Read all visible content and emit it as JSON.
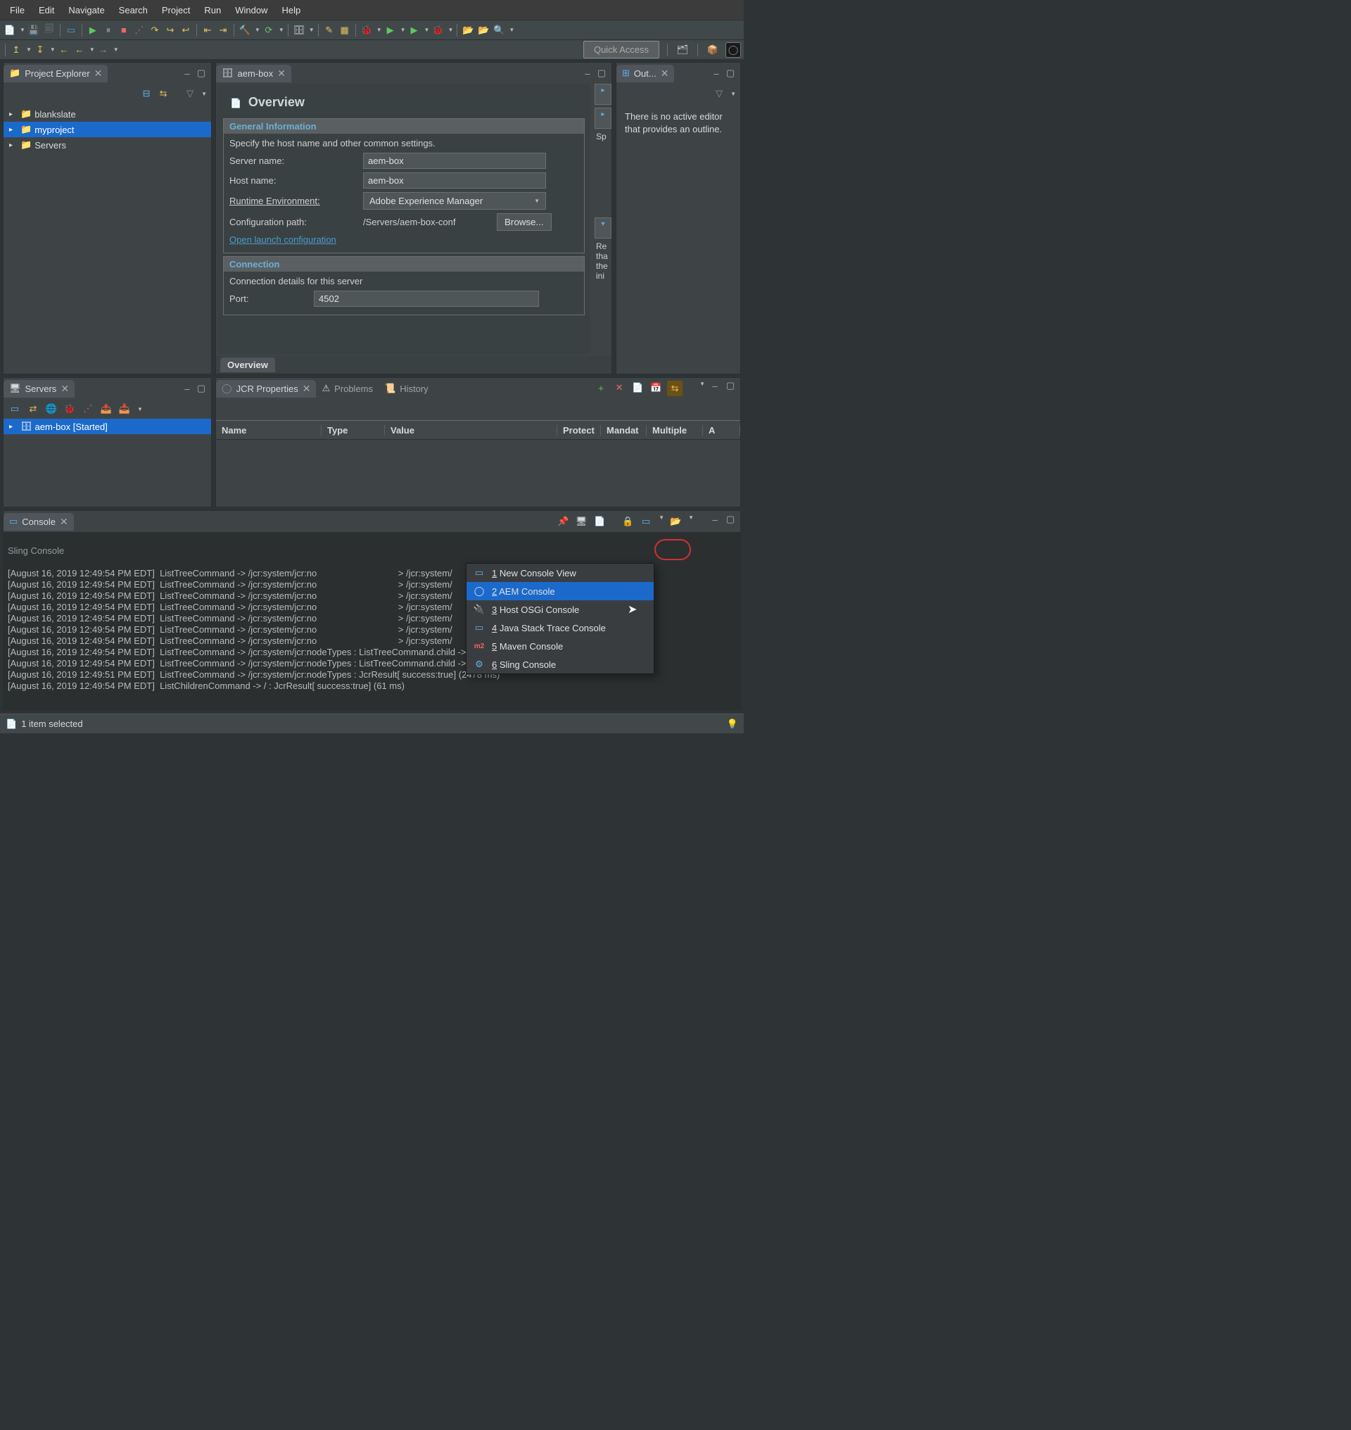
{
  "menu": [
    "File",
    "Edit",
    "Navigate",
    "Search",
    "Project",
    "Run",
    "Window",
    "Help"
  ],
  "quick_access": "Quick Access",
  "project_explorer": {
    "title": "Project Explorer",
    "items": [
      "blankslate",
      "myproject",
      "Servers"
    ],
    "selected": 1
  },
  "editor": {
    "tab": "aem-box",
    "overview_title": "Overview",
    "general": {
      "header": "General Information",
      "desc": "Specify the host name and other common settings.",
      "server_name_label": "Server name:",
      "server_name": "aem-box",
      "host_name_label": "Host name:",
      "host_name": "aem-box",
      "runtime_label": "Runtime Environment:",
      "runtime": "Adobe Experience Manager",
      "config_label": "Configuration path:",
      "config_path": "/Servers/aem-box-conf",
      "browse": "Browse...",
      "open_launch": "Open launch configuration"
    },
    "connection": {
      "header": "Connection",
      "desc": "Connection details for this server",
      "port_label": "Port:",
      "port": "4502"
    },
    "side_labels": [
      "Sp",
      "Re\ntha\nthe\nini"
    ],
    "bottom_tab": "Overview"
  },
  "outline": {
    "title": "Out...",
    "text": "There is no active editor that provides an outline."
  },
  "servers": {
    "title": "Servers",
    "item": "aem-box  [Started]"
  },
  "jcr": {
    "tabs": [
      "JCR Properties",
      "Problems",
      "History"
    ],
    "columns": [
      "Name",
      "Type",
      "Value",
      "Protect",
      "Mandat",
      "Multiple",
      "A"
    ]
  },
  "console": {
    "title": "Console",
    "header": "Sling Console",
    "lines": [
      "[August 16, 2019 12:49:54 PM EDT]  ListTreeCommand -> /jcr:system/jcr:no                                > /jcr:system/",
      "[August 16, 2019 12:49:54 PM EDT]  ListTreeCommand -> /jcr:system/jcr:no                                > /jcr:system/",
      "[August 16, 2019 12:49:54 PM EDT]  ListTreeCommand -> /jcr:system/jcr:no                                > /jcr:system/",
      "[August 16, 2019 12:49:54 PM EDT]  ListTreeCommand -> /jcr:system/jcr:no                                > /jcr:system/",
      "[August 16, 2019 12:49:54 PM EDT]  ListTreeCommand -> /jcr:system/jcr:no                                > /jcr:system/",
      "[August 16, 2019 12:49:54 PM EDT]  ListTreeCommand -> /jcr:system/jcr:no                                > /jcr:system/",
      "[August 16, 2019 12:49:54 PM EDT]  ListTreeCommand -> /jcr:system/jcr:no                                > /jcr:system/",
      "[August 16, 2019 12:49:54 PM EDT]  ListTreeCommand -> /jcr:system/jcr:nodeTypes : ListTreeCommand.child -> /jcr:system/",
      "[August 16, 2019 12:49:54 PM EDT]  ListTreeCommand -> /jcr:system/jcr:nodeTypes : ListTreeCommand.child -> /jcr:system/",
      "[August 16, 2019 12:49:51 PM EDT]  ListTreeCommand -> /jcr:system/jcr:nodeTypes : JcrResult[ success:true] (2478 ms)",
      "[August 16, 2019 12:49:54 PM EDT]  ListChildrenCommand -> / : JcrResult[ success:true] (61 ms)"
    ]
  },
  "context_menu": {
    "items": [
      {
        "key": "1",
        "label": "New Console View"
      },
      {
        "key": "2",
        "label": "AEM Console"
      },
      {
        "key": "3",
        "label": "Host OSGi Console"
      },
      {
        "key": "4",
        "label": "Java Stack Trace Console"
      },
      {
        "key": "5",
        "label": "Maven Console"
      },
      {
        "key": "6",
        "label": "Sling Console"
      }
    ],
    "selected": 1
  },
  "status": "1 item selected"
}
